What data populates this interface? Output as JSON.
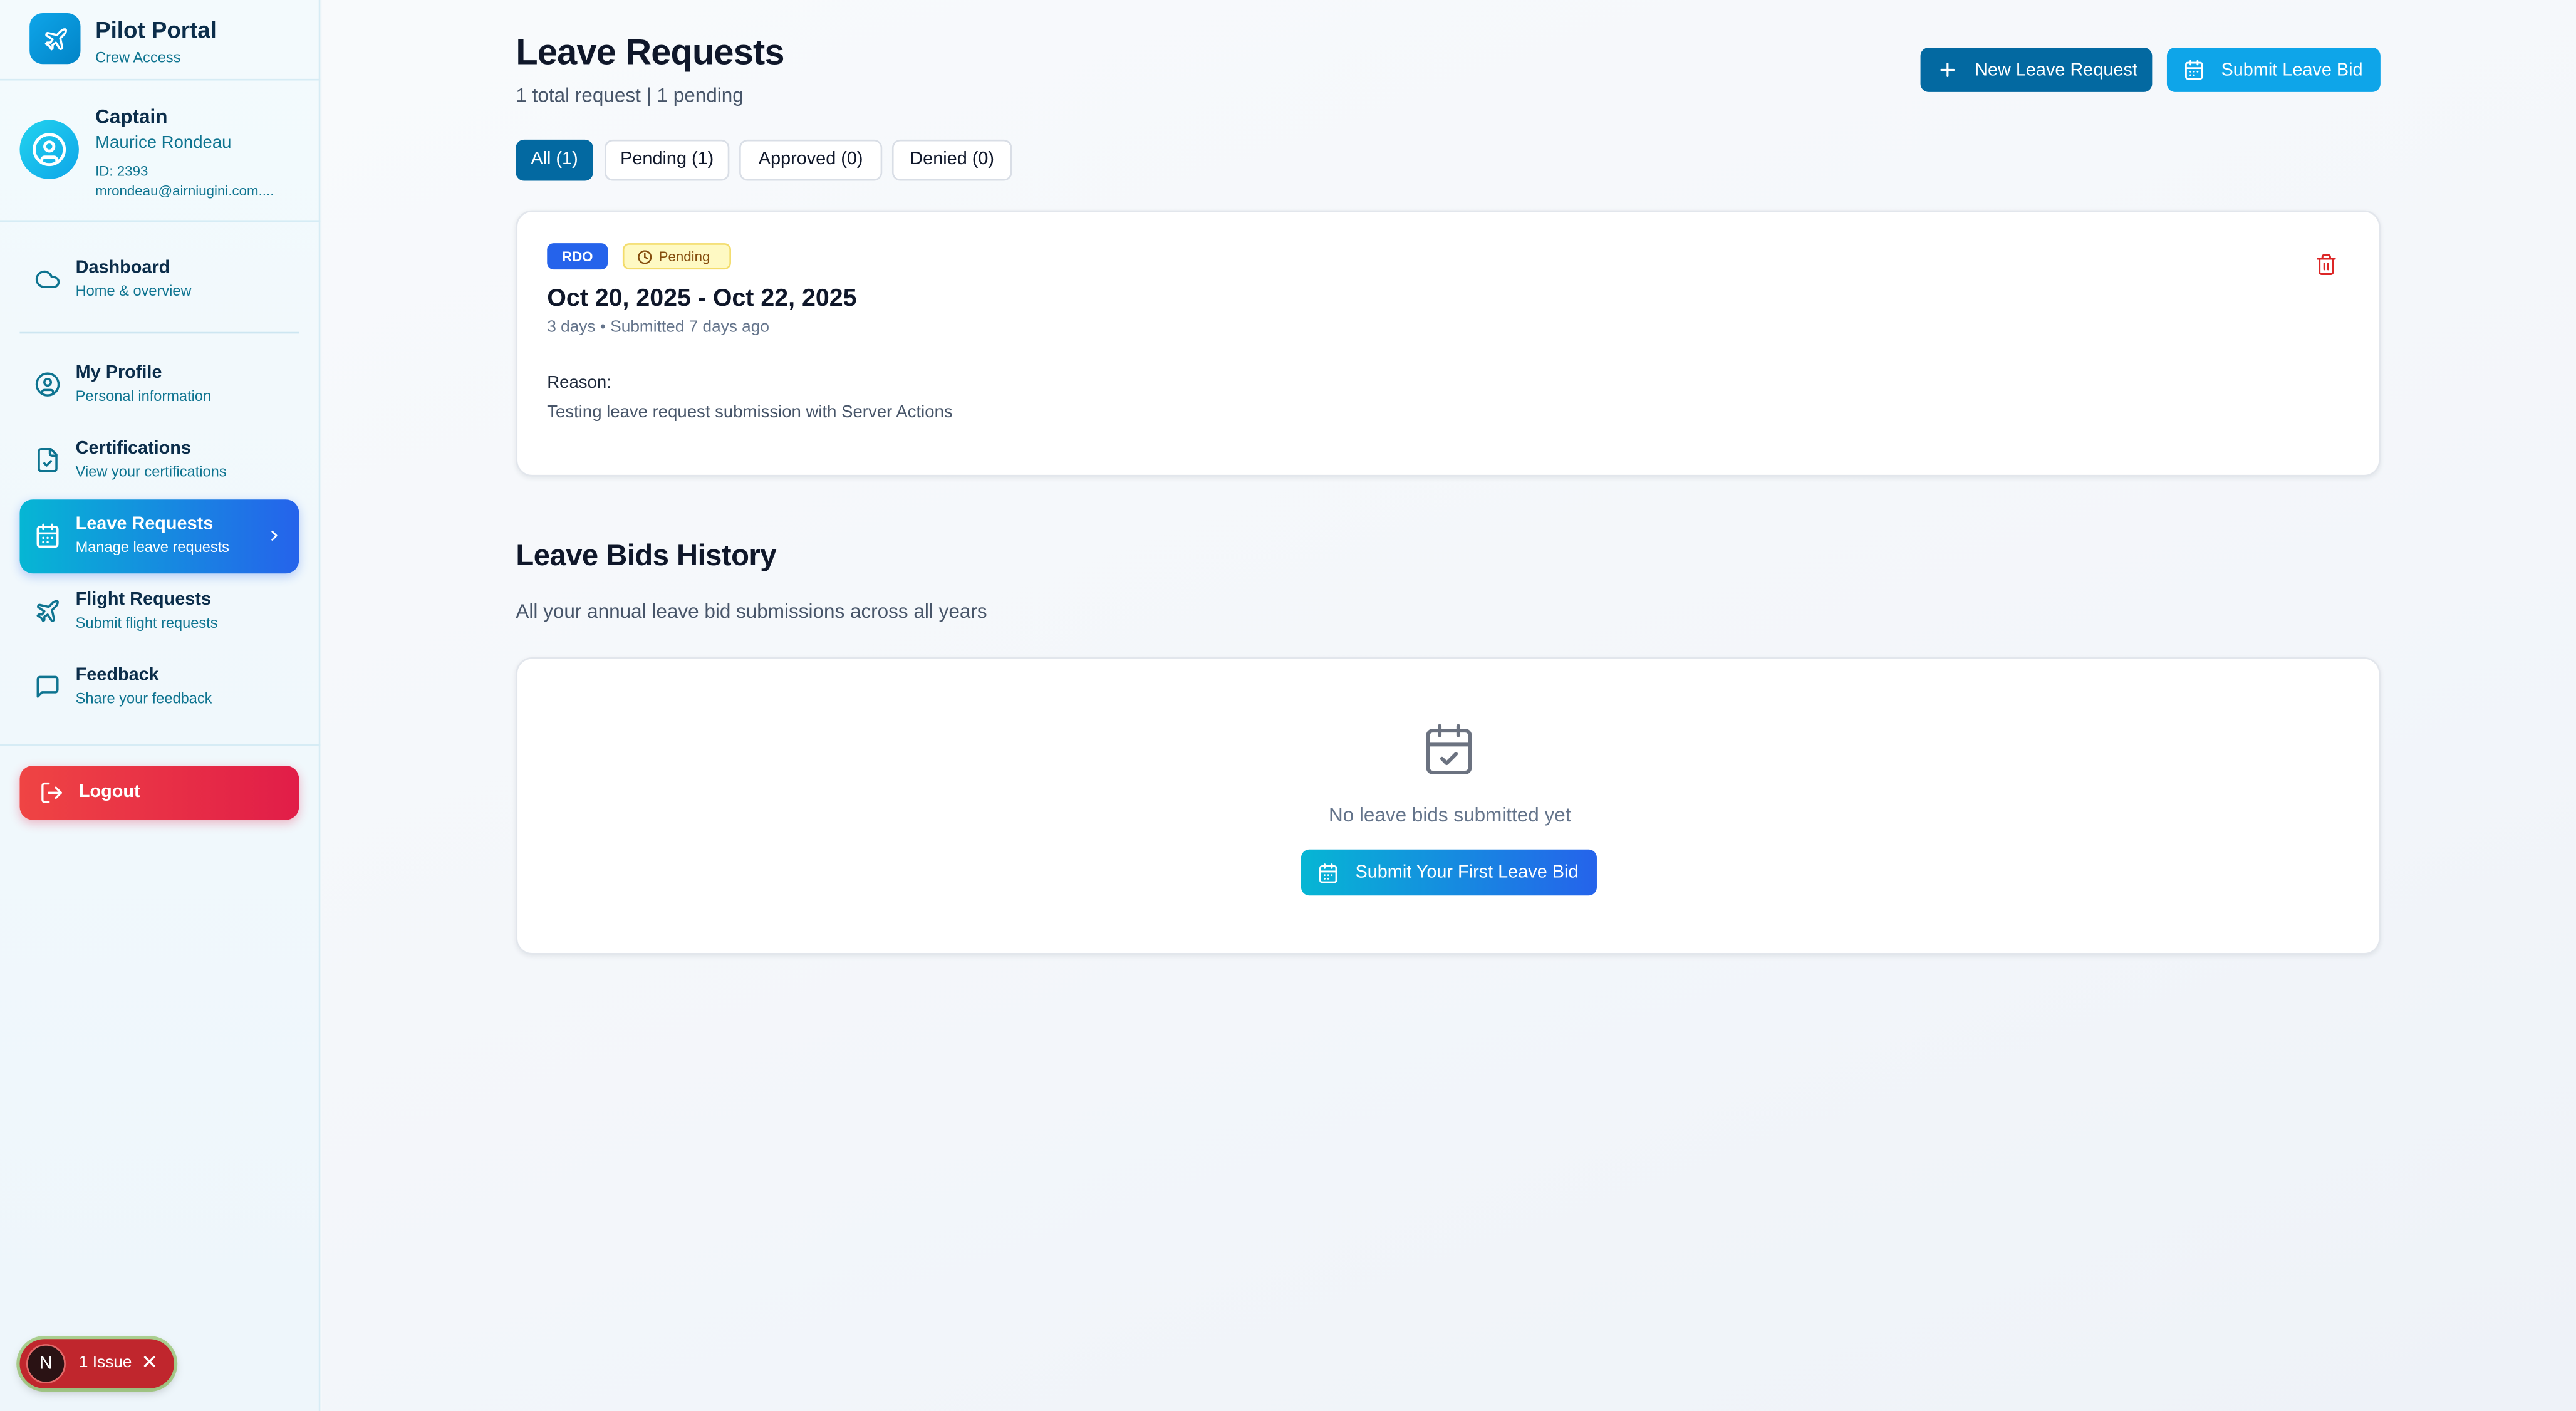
{
  "brand": {
    "title": "Pilot Portal",
    "subtitle": "Crew Access"
  },
  "user": {
    "rank": "Captain",
    "name": "Maurice Rondeau",
    "id": "ID: 2393",
    "email": "mrondeau@airniugini.com...."
  },
  "nav": {
    "dashboard": {
      "label": "Dashboard",
      "sub": "Home & overview"
    },
    "profile": {
      "label": "My Profile",
      "sub": "Personal information"
    },
    "certifications": {
      "label": "Certifications",
      "sub": "View your certifications"
    },
    "leave": {
      "label": "Leave Requests",
      "sub": "Manage leave requests"
    },
    "flight": {
      "label": "Flight Requests",
      "sub": "Submit flight requests"
    },
    "feedback": {
      "label": "Feedback",
      "sub": "Share your feedback"
    },
    "logout": "Logout"
  },
  "issues": {
    "avatar_letter": "N",
    "label": "1 Issue",
    "close": "✕"
  },
  "header": {
    "title": "Leave Requests",
    "subtitle": "1 total request | 1 pending",
    "new_request_label": "New Leave Request",
    "submit_bid_label": "Submit Leave Bid"
  },
  "filters": {
    "all": "All (1)",
    "pending": "Pending (1)",
    "approved": "Approved (0)",
    "denied": "Denied (0)"
  },
  "request": {
    "type": "RDO",
    "status": "Pending",
    "dates": "Oct 20, 2025 - Oct 22, 2025",
    "meta": "3 days • Submitted 7 days ago",
    "reason_label": "Reason:",
    "reason": "Testing leave request submission with Server Actions"
  },
  "bids": {
    "title": "Leave Bids History",
    "subtitle": "All your annual leave bid submissions across all years",
    "empty_text": "No leave bids submitted yet",
    "first_bid_label": "Submit Your First Leave Bid"
  },
  "colors": {
    "primary": "#0369a1",
    "accent": "#0ea5e9",
    "danger": "#e11d48",
    "badge_blue": "#2563eb",
    "pending_bg": "#fef9c3"
  },
  "icons": {
    "brand": "plane-icon",
    "user": "user-circle-icon",
    "dashboard": "cloud-icon",
    "profile": "user-circle-icon",
    "certifications": "file-check-icon",
    "leave": "calendar-icon",
    "flight": "plane-icon",
    "feedback": "message-square-icon",
    "logout": "logout-icon",
    "delete": "trash-icon"
  }
}
